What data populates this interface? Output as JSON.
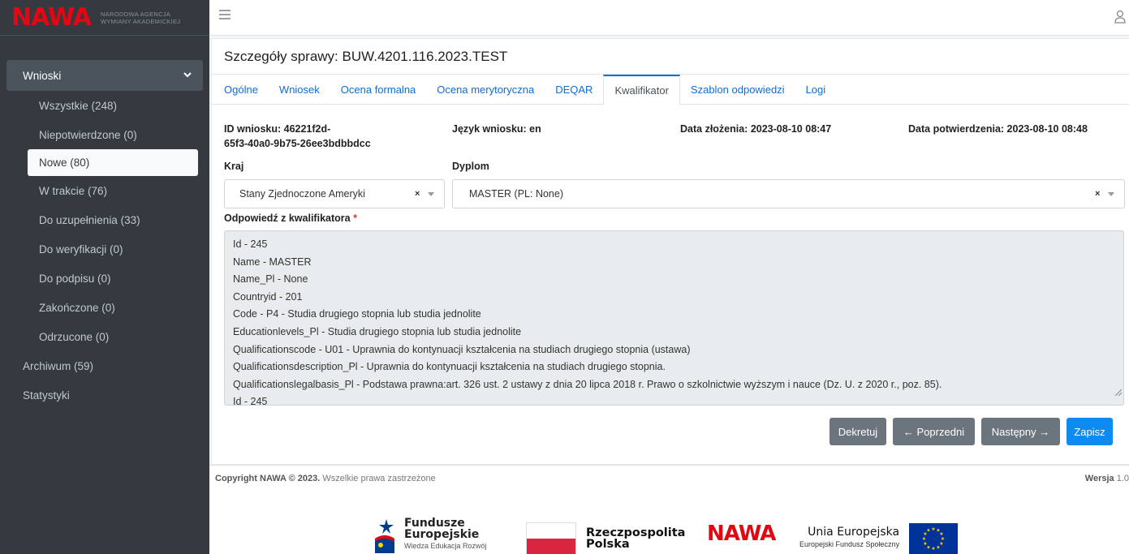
{
  "brand": {
    "logo": "NAWA",
    "subtitle_line1": "NARODOWA AGENCJA",
    "subtitle_line2": "WYMIANY AKADEMICKIEJ"
  },
  "sidebar": {
    "group_label": "Wnioski",
    "items": [
      {
        "label": "Wszystkie (248)"
      },
      {
        "label": "Niepotwierdzone (0)"
      },
      {
        "label": "Nowe (80)"
      },
      {
        "label": "W trakcie (76)"
      },
      {
        "label": "Do uzupełnienia (33)"
      },
      {
        "label": "Do weryfikacji (0)"
      },
      {
        "label": "Do podpisu (0)"
      },
      {
        "label": "Zakończone (0)"
      },
      {
        "label": "Odrzucone (0)"
      }
    ],
    "top_items": [
      {
        "label": "Archiwum (59)"
      },
      {
        "label": "Statystyki"
      }
    ]
  },
  "card": {
    "title": "Szczegóły sprawy: BUW.4201.116.2023.TEST",
    "tabs": [
      "Ogólne",
      "Wniosek",
      "Ocena formalna",
      "Ocena merytoryczna",
      "DEQAR",
      "Kwalifikator",
      "Szablon odpowiedzi",
      "Logi"
    ],
    "active_tab": "Kwalifikator"
  },
  "info": {
    "id_line1": "ID wniosku: 46221f2d-",
    "id_line2": "65f3-40a0-9b75-26ee3bdbbdcc",
    "language": "Język wniosku: en",
    "submitted": "Data złożenia: 2023-08-10 08:47",
    "confirmed": "Data potwierdzenia: 2023-08-10 08:48"
  },
  "form": {
    "country_label": "Kraj",
    "country_value": "Stany Zjednoczone Ameryki",
    "diploma_label": "Dyplom",
    "diploma_value": "MASTER (PL: None)",
    "answer_label": "Odpowiedź z kwalifikatora",
    "required_mark": "*",
    "clear_glyph": "×",
    "answer_lines": [
      "Id - 245",
      "Name - MASTER",
      "Name_Pl - None",
      "Countryid - 201",
      "Code - P4 - Studia drugiego stopnia lub studia jednolite",
      "Educationlevels_Pl - Studia drugiego stopnia lub studia jednolite",
      "Qualificationscode - U01 - Uprawnia do kontynuacji kształcenia na studiach drugiego stopnia (ustawa)",
      "Qualificationsdescription_Pl - Uprawnia do kontynuacji kształcenia na studiach drugiego stopnia.",
      "Qualificationslegalbasis_Pl - Podstawa prawna:art. 326 ust. 2 ustawy z dnia 20 lipca 2018 r. Prawo o szkolnictwie wyższym i nauce (Dz. U. z 2020 r., poz. 85).",
      "Id - 245"
    ]
  },
  "buttons": {
    "dekretuj": "Dekretuj",
    "previous": "← Poprzedni",
    "next": "Następny →",
    "save": "Zapisz"
  },
  "footer": {
    "copyright_bold": "Copyright NAWA © 2023.",
    "copyright_rest": " Wszelkie prawa zastrzeżone",
    "version_label": "Wersja",
    "version_value": "1.0"
  },
  "logos": {
    "fe_line1": "Fundusze",
    "fe_line2": "Europejskie",
    "fe_line3": "Wiedza Edukacja Rozwój",
    "rp_line1": "Rzeczpospolita",
    "rp_line2": "Polska",
    "nawa": "NAWA",
    "ue_line1": "Unia Europejska",
    "ue_line2": "Europejski Fundusz Społeczny"
  }
}
